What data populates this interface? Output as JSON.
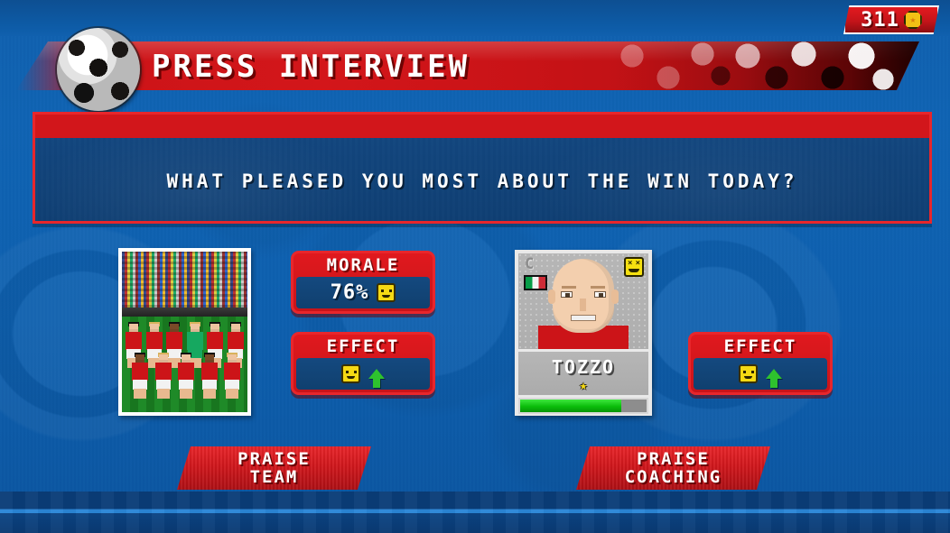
{
  "header": {
    "title": "PRESS INTERVIEW",
    "ball_icon": "soccer-ball-icon",
    "currency": {
      "value": "311",
      "icon": "coin-icon"
    }
  },
  "question": {
    "text": "WHAT PLEASED YOU MOST ABOUT THE WIN TODAY?"
  },
  "team_option": {
    "photo_alt": "team-photo",
    "morale": {
      "label": "MORALE",
      "value": "76%",
      "mood_icon": "smiley-icon"
    },
    "effect": {
      "label": "EFFECT",
      "mood_icon": "smiley-icon",
      "direction_icon": "up-arrow-icon"
    },
    "button": {
      "line1": "PRAISE",
      "line2": "TEAM"
    }
  },
  "player_option": {
    "card": {
      "captain_badge": "C",
      "nationality_icon": "italy-flag-icon",
      "mood_icon": "excited-smiley-icon",
      "name": "TOZZO",
      "stars": "★",
      "condition_percent": 80
    },
    "effect": {
      "label": "EFFECT",
      "mood_icon": "smiley-icon",
      "direction_icon": "up-arrow-icon"
    },
    "button": {
      "line1": "PRAISE",
      "line2": "COACHING"
    }
  },
  "colors": {
    "background_blue": "#0d5fae",
    "panel_red": "#d2161b",
    "panel_dark_blue": "#12467e",
    "accent_green": "#0bbd0b",
    "mood_yellow": "#f5d914"
  }
}
